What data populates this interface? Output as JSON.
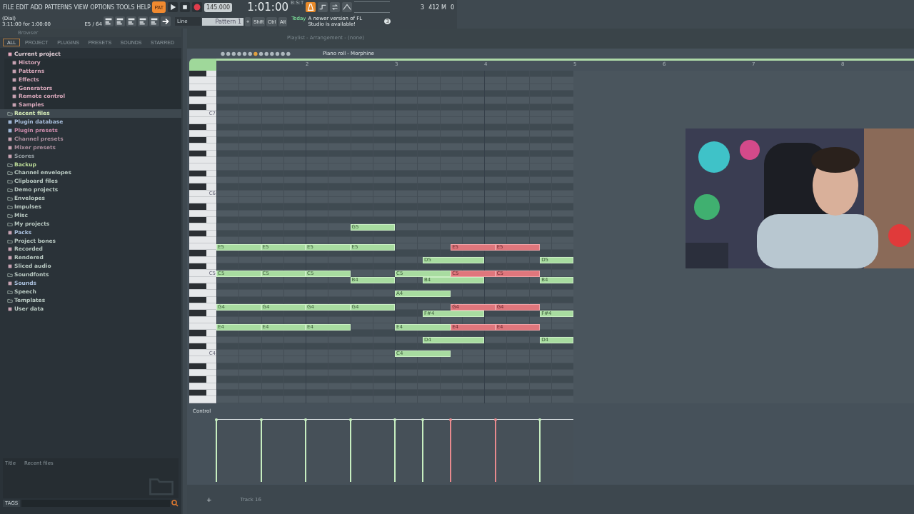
{
  "menu": [
    "FILE",
    "EDIT",
    "ADD",
    "PATTERNS",
    "VIEW",
    "OPTIONS",
    "TOOLS",
    "HELP"
  ],
  "transport": {
    "mode": "PAT",
    "pattern_mode": true,
    "tempo": "145.000",
    "time": "1:01:00",
    "time_format": "B:S:T"
  },
  "meters": {
    "voices": "3",
    "memory": "412 M",
    "cpu": "0"
  },
  "hint": {
    "title": "(Dial)",
    "text": "3:11:00 for 1:00:00",
    "note": "E5 / 64"
  },
  "snap": "Line",
  "pattern": "Pattern 1",
  "pattern_add": "+",
  "modifiers": [
    "Shift",
    "Ctrl",
    "Alt"
  ],
  "news": {
    "when": "Today",
    "text": "A newer version of FL Studio is available!",
    "count": "3"
  },
  "browser": {
    "title": "Browser",
    "tabs": [
      {
        "label": "ALL",
        "selected": true
      },
      {
        "label": "PROJECT",
        "selected": false
      },
      {
        "label": "PLUGINS",
        "selected": false
      },
      {
        "label": "PRESETS",
        "selected": false
      },
      {
        "label": "SOUNDS",
        "selected": false
      },
      {
        "label": "STARRED",
        "selected": false
      }
    ],
    "items": [
      {
        "label": "Current project",
        "kind": "project",
        "color": "#e6d2da",
        "expanded": true,
        "selected": false,
        "children": [
          {
            "label": "History",
            "kind": "file",
            "color": "#d9a9bc"
          },
          {
            "label": "Patterns",
            "kind": "file",
            "color": "#d9a9bc"
          },
          {
            "label": "Effects",
            "kind": "file",
            "color": "#d9a9bc"
          },
          {
            "label": "Generators",
            "kind": "file",
            "color": "#d9a9bc"
          },
          {
            "label": "Remote control",
            "kind": "file",
            "color": "#d9a9bc"
          },
          {
            "label": "Samples",
            "kind": "file",
            "color": "#d9a9bc"
          }
        ]
      },
      {
        "label": "Recent files",
        "kind": "folder",
        "color": "#d6ecb8",
        "selected": true
      },
      {
        "label": "Plugin database",
        "kind": "plugin",
        "color": "#a9bfdc",
        "selected": false
      },
      {
        "label": "Plugin presets",
        "kind": "plugin",
        "color": "#c98aa9",
        "selected": false
      },
      {
        "label": "Channel presets",
        "kind": "file",
        "color": "#a98d9c",
        "selected": false
      },
      {
        "label": "Mixer presets",
        "kind": "file",
        "color": "#a98d9c",
        "selected": false
      },
      {
        "label": "Scores",
        "kind": "file",
        "color": "#9aa3a8",
        "selected": false
      },
      {
        "label": "Backup",
        "kind": "folder",
        "color": "#bcdc98",
        "selected": false
      },
      {
        "label": "Channel envelopes",
        "kind": "folder",
        "color": "#b9c9c2",
        "selected": false
      },
      {
        "label": "Clipboard files",
        "kind": "folder",
        "color": "#b9c9c2",
        "selected": false
      },
      {
        "label": "Demo projects",
        "kind": "folder",
        "color": "#b9c9c2",
        "selected": false
      },
      {
        "label": "Envelopes",
        "kind": "folder",
        "color": "#b9c9c2",
        "selected": false
      },
      {
        "label": "Impulses",
        "kind": "folder",
        "color": "#b9c9c2",
        "selected": false
      },
      {
        "label": "Misc",
        "kind": "folder",
        "color": "#b9c9c2",
        "selected": false
      },
      {
        "label": "My projects",
        "kind": "folder",
        "color": "#b9c9c2",
        "selected": false
      },
      {
        "label": "Packs",
        "kind": "file",
        "color": "#a9bfdc",
        "selected": false
      },
      {
        "label": "Project bones",
        "kind": "folder",
        "color": "#b9c9c2",
        "selected": false
      },
      {
        "label": "Recorded",
        "kind": "file",
        "color": "#b9c9c2",
        "selected": false
      },
      {
        "label": "Rendered",
        "kind": "file",
        "color": "#b9c9c2",
        "selected": false
      },
      {
        "label": "Sliced audio",
        "kind": "file",
        "color": "#b9c9c2",
        "selected": false
      },
      {
        "label": "Soundfonts",
        "kind": "folder",
        "color": "#b9c9c2",
        "selected": false
      },
      {
        "label": "Sounds",
        "kind": "file",
        "color": "#a9bfdc",
        "selected": false
      },
      {
        "label": "Speech",
        "kind": "folder",
        "color": "#b9c9c2",
        "selected": false
      },
      {
        "label": "Templates",
        "kind": "folder",
        "color": "#b9c9c2",
        "selected": false
      },
      {
        "label": "User data",
        "kind": "file",
        "color": "#b9c9c2",
        "selected": false
      }
    ],
    "footer": {
      "column_1": "Title",
      "column_2": "Recent files"
    },
    "tags": "TAGS"
  },
  "playlist": {
    "title": "Playlist - Arrangement - (none)"
  },
  "piano_roll": {
    "title": "Piano roll - Morphine",
    "ruler": [
      "2",
      "3",
      "4",
      "5",
      "6",
      "7",
      "8"
    ],
    "octave_labels": [
      "C7",
      "C6",
      "C5",
      "C4"
    ],
    "notes": [
      {
        "label": "G5",
        "selected": false
      },
      {
        "label": "E5",
        "selected": false
      },
      {
        "label": "E5",
        "selected": false
      },
      {
        "label": "E5",
        "selected": false
      },
      {
        "label": "E5",
        "selected": false
      },
      {
        "label": "E5",
        "selected": true
      },
      {
        "label": "E5",
        "selected": true
      },
      {
        "label": "D5",
        "selected": false
      },
      {
        "label": "D5",
        "selected": false
      },
      {
        "label": "C5",
        "selected": false
      },
      {
        "label": "C5",
        "selected": false
      },
      {
        "label": "C5",
        "selected": false
      },
      {
        "label": "C5",
        "selected": false
      },
      {
        "label": "C5",
        "selected": true
      },
      {
        "label": "C5",
        "selected": true
      },
      {
        "label": "B4",
        "selected": false
      },
      {
        "label": "B4",
        "selected": false
      },
      {
        "label": "B4",
        "selected": false
      },
      {
        "label": "A4",
        "selected": false
      },
      {
        "label": "G4",
        "selected": false
      },
      {
        "label": "G4",
        "selected": false
      },
      {
        "label": "G4",
        "selected": false
      },
      {
        "label": "G4",
        "selected": false
      },
      {
        "label": "G4",
        "selected": true
      },
      {
        "label": "G4",
        "selected": true
      },
      {
        "label": "F#4",
        "selected": false
      },
      {
        "label": "F#4",
        "selected": false
      },
      {
        "label": "E4",
        "selected": false
      },
      {
        "label": "E4",
        "selected": false
      },
      {
        "label": "E4",
        "selected": false
      },
      {
        "label": "E4",
        "selected": false
      },
      {
        "label": "E4",
        "selected": true
      },
      {
        "label": "E4",
        "selected": true
      },
      {
        "label": "D4",
        "selected": false
      },
      {
        "label": "D4",
        "selected": false
      },
      {
        "label": "C4",
        "selected": false
      }
    ],
    "control": "Control",
    "add": "+"
  },
  "track_label": "Track 16"
}
